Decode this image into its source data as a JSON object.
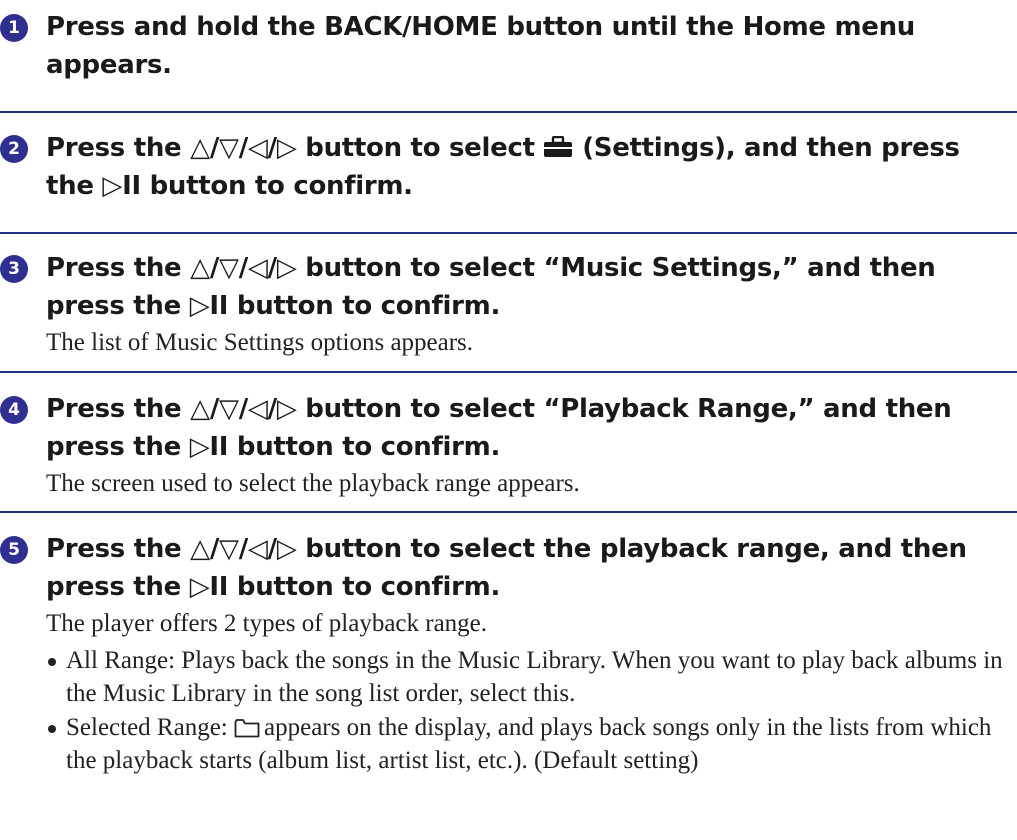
{
  "steps": [
    {
      "number": "1",
      "heading": "Press and hold the BACK/HOME button until the Home menu appears."
    },
    {
      "number": "2",
      "heading": "Press the △/▽/◁/▷ button to select 💼 (Settings), and then press the ▷II button to confirm."
    },
    {
      "number": "3",
      "heading": "Press the △/▽/◁/▷ button to select “Music Settings,” and then press the ▷II button to confirm.",
      "description": "The list of Music Settings options appears."
    },
    {
      "number": "4",
      "heading": "Press the △/▽/◁/▷ button to select “Playback Range,” and then press the ▷II button to confirm.",
      "description": "The screen used to select the playback range appears."
    },
    {
      "number": "5",
      "heading": "Press the △/▽/◁/▷ button to select the playback range, and then press the ▷II button to confirm.",
      "description": "The player offers 2 types of playback range.",
      "bullets": [
        "All Range: Plays back the songs in the Music Library. When you want to play back albums in the Music Library in the song list order, select this.",
        "Selected Range:  appears on the display, and plays back songs only in the lists from which the playback starts (album list, artist list, etc.). (Default setting)"
      ]
    }
  ],
  "icons": {
    "settings": "toolbox-icon",
    "folder": "folder-icon"
  },
  "colors": {
    "accent": "#2f2f8f",
    "rule": "#1f3080"
  }
}
